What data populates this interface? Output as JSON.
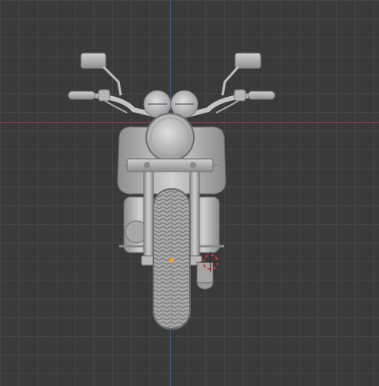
{
  "viewport": {
    "background": "#3a3a3a",
    "grid_color": "#454545",
    "axis_x_color": "#9a3b45",
    "axis_y_color": "#2f5aa8",
    "object_color": "#b9b9b9",
    "origin_color": "#f0a030",
    "cursor_color": "#d9303a"
  },
  "scene": {
    "object": "motorcycle-front-view",
    "view": "front-orthographic"
  }
}
